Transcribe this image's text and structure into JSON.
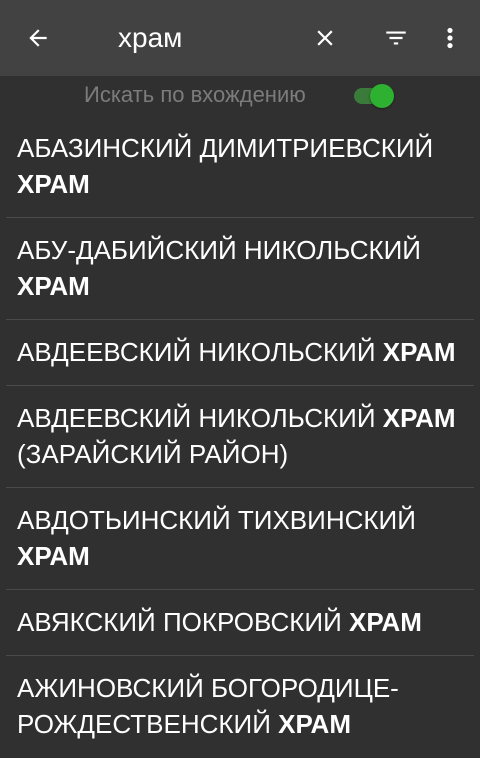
{
  "toolbar": {
    "back_icon": "arrow-back-icon",
    "search_value": "храм",
    "clear_icon": "close-icon",
    "filter_icon": "filter-icon",
    "menu_icon": "more-vert-icon"
  },
  "search_option": {
    "label": "Искать по вхождению",
    "enabled": true,
    "accent_color": "#2eb030"
  },
  "results": [
    {
      "prefix": "АБАЗИНСКИЙ ДИМИТРИЕВСКИЙ ",
      "match": "ХРАМ",
      "suffix": ""
    },
    {
      "prefix": "АБУ-ДАБИЙСКИЙ НИКОЛЬСКИЙ ",
      "match": "ХРАМ",
      "suffix": ""
    },
    {
      "prefix": "АВДЕЕВСКИЙ НИКОЛЬСКИЙ ",
      "match": "ХРАМ",
      "suffix": ""
    },
    {
      "prefix": "АВДЕЕВСКИЙ НИКОЛЬСКИЙ ",
      "match": "ХРАМ",
      "suffix": " (ЗАРАЙСКИЙ РАЙОН)"
    },
    {
      "prefix": "АВДОТЬИНСКИЙ ТИХВИНСКИЙ ",
      "match": "ХРАМ",
      "suffix": ""
    },
    {
      "prefix": "АВЯКСКИЙ ПОКРОВСКИЙ ",
      "match": "ХРАМ",
      "suffix": ""
    },
    {
      "prefix": "АЖИНОВСКИЙ БОГОРОДИЦЕ-РОЖДЕСТВЕНСКИЙ ",
      "match": "ХРАМ",
      "suffix": ""
    }
  ]
}
